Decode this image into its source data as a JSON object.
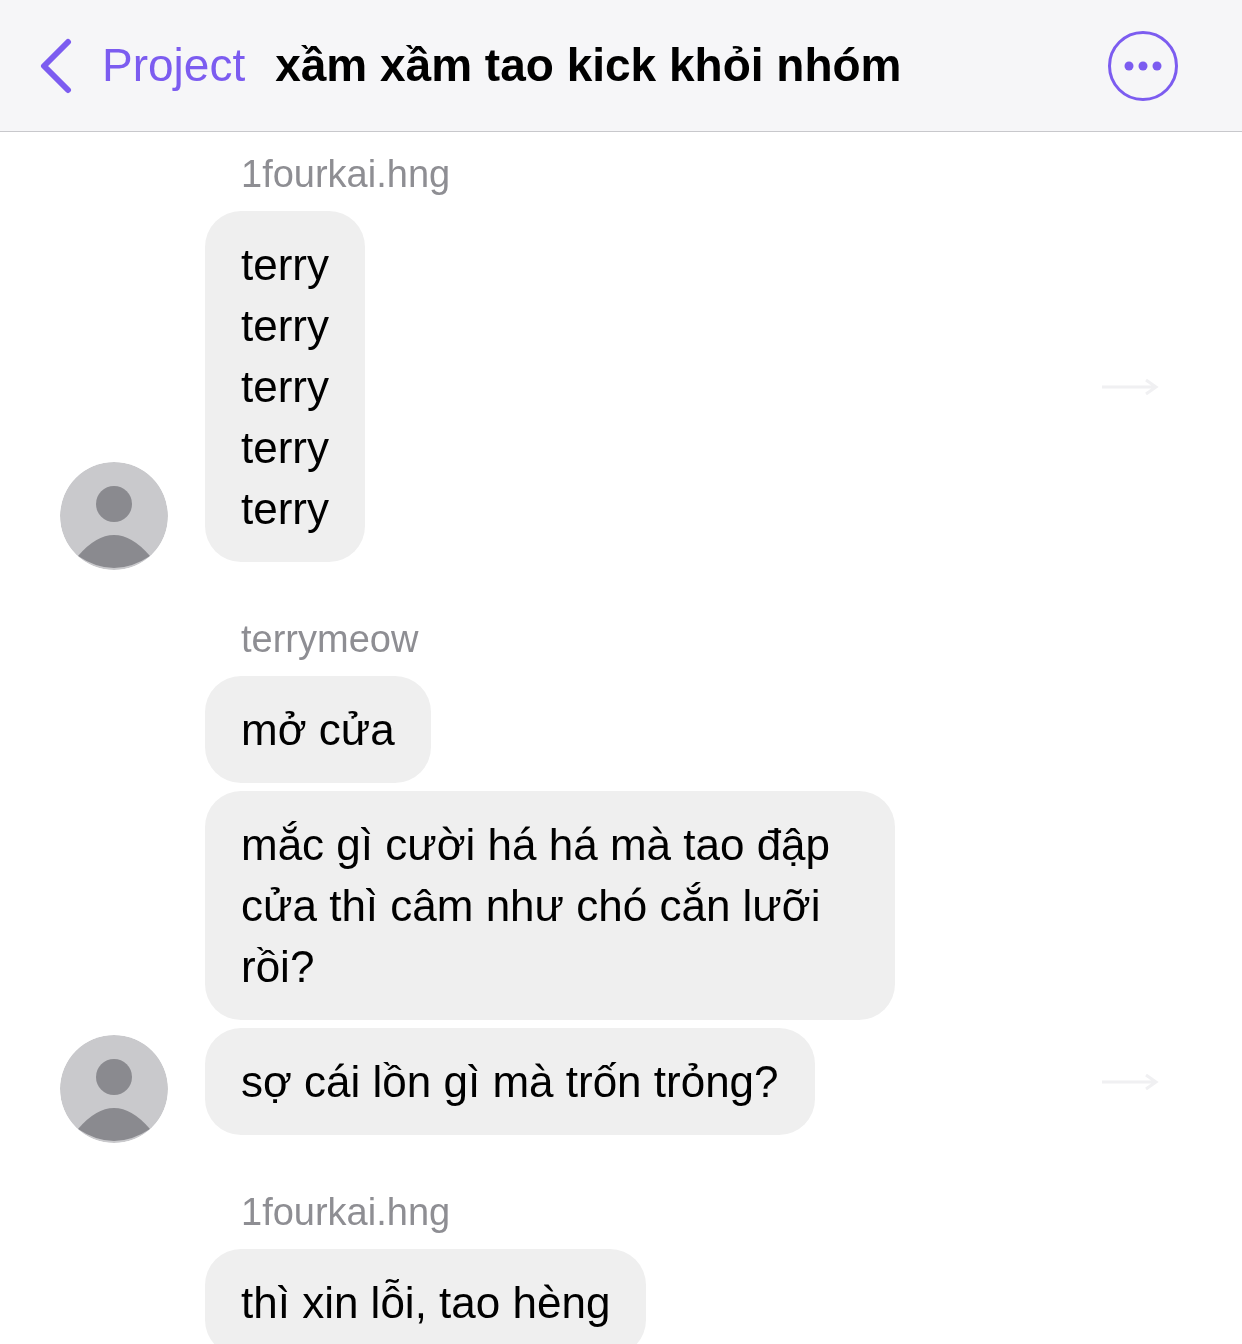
{
  "header": {
    "back_label": "Project",
    "title": "xầm xầm tao kick khỏi nhóm"
  },
  "groups": [
    {
      "sender": "1fourkai.hng",
      "avatar": true,
      "messages": [
        {
          "text": "terry\nterry\nterry\nterry\nterry",
          "forward": true
        }
      ]
    },
    {
      "sender": "terrymeow",
      "avatar": true,
      "messages": [
        {
          "text": "mở cửa",
          "forward": false
        },
        {
          "text": "mắc gì cười há há mà tao đập cửa thì câm như chó cắn lưỡi rồi?",
          "forward": false
        },
        {
          "text": "sợ cái lồn gì mà trốn trỏng?",
          "forward": true
        }
      ]
    },
    {
      "sender": "1fourkai.hng",
      "avatar": false,
      "messages": [
        {
          "text": "thì xin lỗi, tao hèng",
          "forward": false
        }
      ]
    }
  ]
}
